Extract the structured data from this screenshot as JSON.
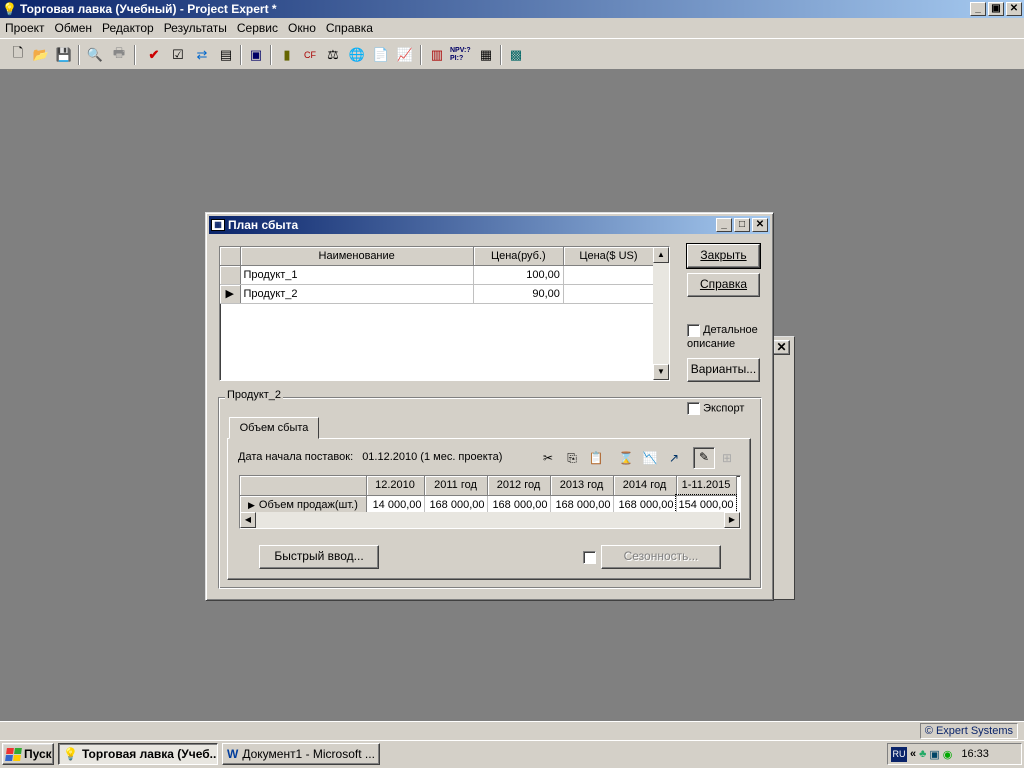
{
  "app": {
    "title": "Торговая лавка (Учебный) - Project Expert *",
    "menu": [
      "Проект",
      "Обмен",
      "Редактор",
      "Результаты",
      "Сервис",
      "Окно",
      "Справка"
    ],
    "caption_buttons": {
      "minimize": "_",
      "restore": "▣",
      "close": "✕"
    }
  },
  "toolbar": {
    "icons": [
      "new-icon",
      "open-icon",
      "save-icon",
      "preview-icon",
      "print-icon",
      "check-icon",
      "list-check-icon",
      "sync-icon",
      "doc-list-icon",
      "screen-icon",
      "book-icon",
      "cashflow-icon",
      "balance-icon",
      "globe-icon",
      "report-icon",
      "chart-icon",
      "table-chart-icon",
      "npv-icon",
      "calculator-icon",
      "analysis-icon"
    ],
    "npv_label": "NPV:? PI:?"
  },
  "dialog": {
    "title": "План сбыта",
    "products_table": {
      "headers": [
        "Наименование",
        "Цена(руб.)",
        "Цена($ US)"
      ],
      "rows": [
        {
          "name": "Продукт_1",
          "price_rub": "100,00",
          "price_usd": "",
          "current": false
        },
        {
          "name": "Продукт_2",
          "price_rub": "90,00",
          "price_usd": "",
          "current": true
        }
      ]
    },
    "buttons": {
      "close": "Закрыть",
      "help": "Справка",
      "variants": "Варианты...",
      "quick_input": "Быстрый ввод...",
      "seasonality": "Сезонность..."
    },
    "detailed_description": "Детальное описание",
    "export_label": "Экспорт",
    "group_title": "Продукт_2",
    "tab_label": "Объем сбыта",
    "start_date_label": "Дата начала поставок:",
    "start_date_value": "01.12.2010 (1 мес. проекта)",
    "volume_table": {
      "headers": [
        "12.2010",
        "2011 год",
        "2012 год",
        "2013 год",
        "2014 год",
        "1-11.2015"
      ],
      "row_label": "Объем продаж(шт.)",
      "values": [
        "14 000,00",
        "168 000,00",
        "168 000,00",
        "168 000,00",
        "168 000,00",
        "154 000,00"
      ]
    }
  },
  "status": {
    "link": "© Expert Systems"
  },
  "taskbar": {
    "start": "Пуск",
    "tasks": [
      "Торговая лавка (Учеб...",
      "Документ1 - Microsoft ..."
    ],
    "lang": "RU",
    "time": "16:33"
  }
}
